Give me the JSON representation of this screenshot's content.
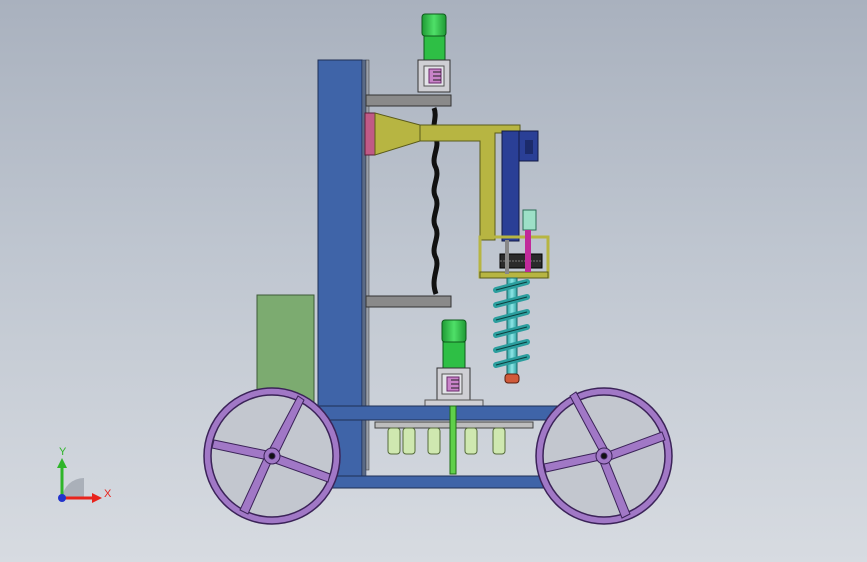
{
  "axes_triad": {
    "x_label": "X",
    "y_label": "Y",
    "x_color": "#e8231c",
    "y_color": "#2fb52a",
    "z_color": "#2233cc"
  },
  "colors": {
    "column": "#3f64a8",
    "arm": "#b7b542",
    "motor": "#33c44a",
    "gearbox": "#cfcfd4",
    "auger": "#3fbdbd",
    "wheel": "#a178c6",
    "hopper": "#7cab70",
    "rail": "#8a8a8a"
  },
  "icons": [
    "axis-triad-icon"
  ]
}
